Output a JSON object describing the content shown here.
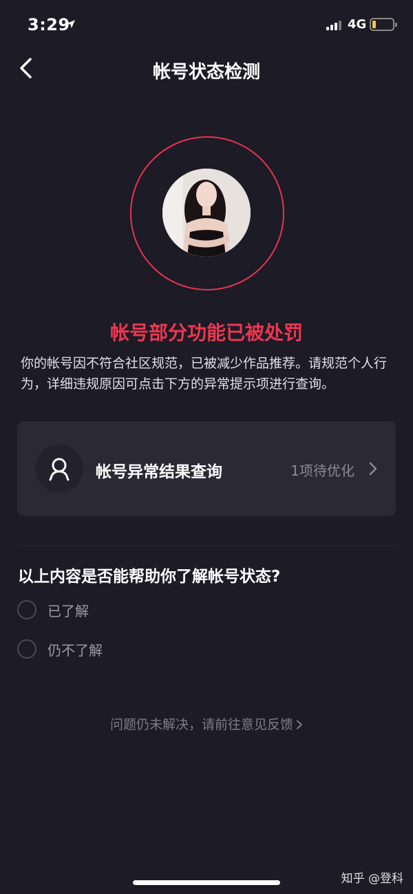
{
  "status_bar": {
    "time": "3:29",
    "network": "4G",
    "location_icon": "location-arrow-icon",
    "signal_icon": "cellular-signal-icon",
    "battery_icon": "battery-low-icon",
    "battery_color": "#f5c542"
  },
  "nav": {
    "back_icon": "chevron-left-icon",
    "title": "帐号状态检测"
  },
  "account": {
    "avatar_ring_color": "#e8344f",
    "warning_title": "帐号部分功能已被处罚",
    "warning_color": "#ee3650",
    "description": "你的帐号因不符合社区规范，已被减少作品推荐。请规范个人行为，详细违规原因可点击下方的异常提示项进行查询。"
  },
  "query_card": {
    "icon": "user-outline-icon",
    "title": "帐号异常结果查询",
    "status": "1项待优化",
    "chevron_icon": "chevron-right-icon"
  },
  "survey": {
    "question": "以上内容是否能帮助你了解帐号状态?",
    "options": [
      {
        "label": "已了解",
        "selected": false
      },
      {
        "label": "仍不了解",
        "selected": false
      }
    ]
  },
  "feedback": {
    "label": "问题仍未解决，请前往意见反馈"
  },
  "watermark": "知乎 @登科"
}
